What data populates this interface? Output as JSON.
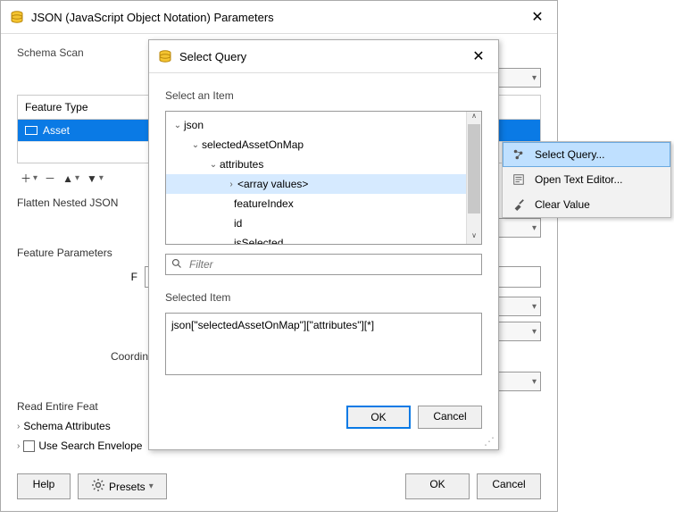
{
  "main": {
    "title": "JSON (JavaScript Object Notation) Parameters",
    "schema_scan_label": "Schema Scan",
    "feature_type_header": "Feature Type",
    "feature_type_rows": [
      "Asset"
    ],
    "flatten_label": "Flatten Nested JSON",
    "feature_params_label": "Feature Parameters",
    "f_label": "F",
    "coord_label": "Coordin",
    "read_entire_label": "Read Entire Feat",
    "schema_attr_label": "Schema Attributes",
    "use_search_env_label": "Use Search Envelope",
    "help_label": "Help",
    "presets_label": "Presets",
    "ok_label": "OK",
    "cancel_label": "Cancel"
  },
  "ctx": {
    "select_query": "Select Query...",
    "open_editor": "Open Text Editor...",
    "clear_value": "Clear Value"
  },
  "sq": {
    "title": "Select Query",
    "select_item_label": "Select an Item",
    "tree": {
      "n0": "json",
      "n1": "selectedAssetOnMap",
      "n2": "attributes",
      "n3": "<array values>",
      "n4": "featureIndex",
      "n5": "id",
      "n6": "isSelected"
    },
    "filter_placeholder": "Filter",
    "selected_label": "Selected Item",
    "selected_value": "json[\"selectedAssetOnMap\"][\"attributes\"][*]",
    "ok_label": "OK",
    "cancel_label": "Cancel"
  }
}
